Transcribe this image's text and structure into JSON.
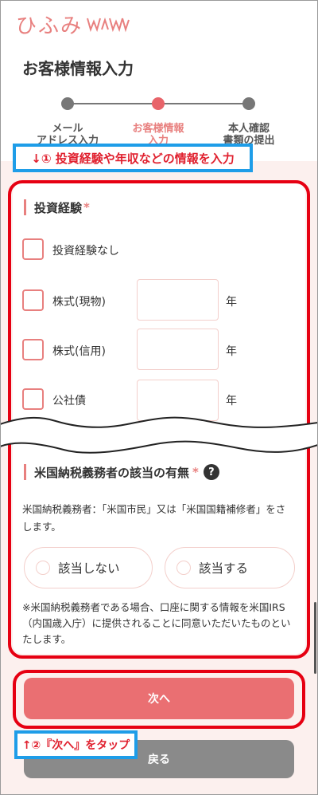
{
  "logo": {
    "text": "ひふみ"
  },
  "page": {
    "title": "お客様情報入力"
  },
  "stepper": {
    "steps": [
      {
        "label": "メール\nアドレス入力"
      },
      {
        "label": "お客様情報\n入力"
      },
      {
        "label": "本人確認\n書類の提出"
      }
    ]
  },
  "annotations": {
    "first": "↓① 投資経験や年収などの情報を入力",
    "second": "↑②『次へ』をタップ"
  },
  "investment": {
    "title": "投資経験",
    "required_mark": "*",
    "none_label": "投資経験なし",
    "rows": [
      {
        "label": "株式(現物)",
        "unit": "年",
        "value": ""
      },
      {
        "label": "株式(信用)",
        "unit": "年",
        "value": ""
      },
      {
        "label": "公社債",
        "unit": "年",
        "value": ""
      }
    ]
  },
  "us_tax": {
    "title": "米国納税義務者の該当の有無",
    "required_mark": "*",
    "help": "?",
    "description": "米国納税義務者：「米国市民」又は「米国国籍補修者」をさします。",
    "options": [
      "該当しない",
      "該当する"
    ],
    "note": "※米国納税義務者である場合、口座に関する情報を米国IRS（内国歳入庁）に提供されることに同意いただいたものといたします。"
  },
  "buttons": {
    "next": "次へ",
    "back": "戻る"
  },
  "colors": {
    "accent": "#e8807f",
    "annotation_red": "#e60012",
    "annotation_blue": "#1e9de8",
    "next_button": "#ea6f72",
    "back_button": "#8a8a8a",
    "background": "#fcf0ee"
  }
}
